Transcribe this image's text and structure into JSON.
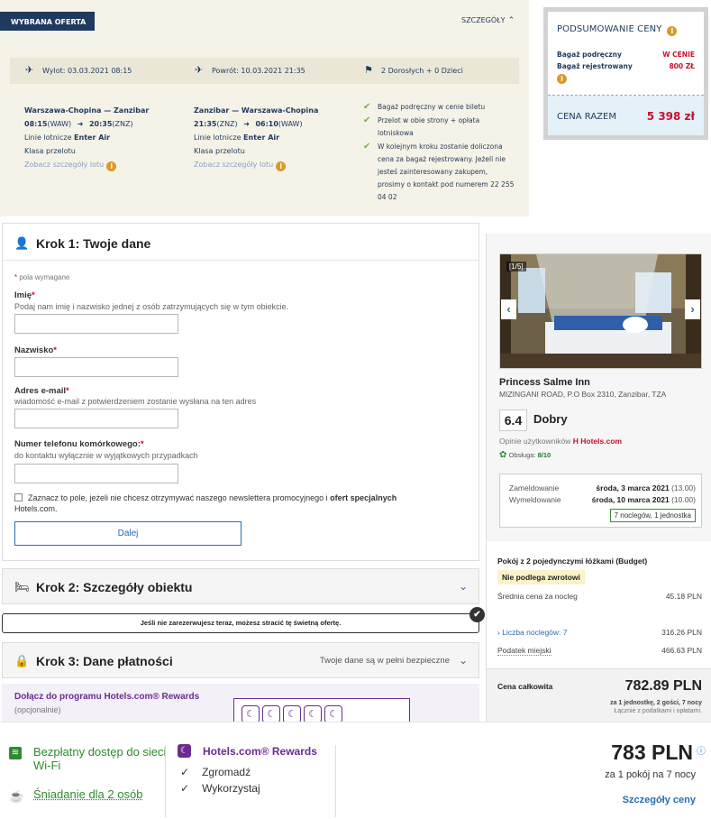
{
  "offer": {
    "tag": "WYBRANA OFERTA",
    "details_label": "SZCZEGÓŁY",
    "departure": "Wylot: 03.03.2021 08:15",
    "return": "Powrót: 10.03.2021 21:35",
    "passengers": "2 Dorosłych + 0 Dzieci",
    "outbound": {
      "route": "Warszawa-Chopina — Zanzibar",
      "dep_time": "08:15",
      "dep_code": "(WAW)",
      "arr_time": "20:35",
      "arr_code": "(ZNZ)",
      "airline_prefix": "Linie lotnicze ",
      "airline": "Enter Air",
      "class": "Klasa przelotu",
      "link": "Zobacz szczegóły lotu"
    },
    "inbound": {
      "route": "Zanzibar — Warszawa-Chopina",
      "dep_time": "21:35",
      "dep_code": "(ZNZ)",
      "arr_time": "06:10",
      "arr_code": "(WAW)",
      "airline_prefix": "Linie lotnicze ",
      "airline": "Enter Air",
      "class": "Klasa przelotu",
      "link": "Zobacz szczegóły lotu"
    },
    "checks": [
      "Bagaż podręczny w cenie biletu",
      "Przelot w obie strony + opłata lotniskowa",
      "W kolejnym kroku zostanie doliczona cena za bagaż rejestrowany. Jeżeli nie jesteś zainteresowany zakupem, prosimy o kontakt pod numerem 22 255 04 02"
    ]
  },
  "summary": {
    "title": "PODSUMOWANIE CENY",
    "row1_label": "Bagaż podręczny",
    "row1_value": "W CENIE",
    "row2_label": "Bagaż rejestrowany",
    "row2_value": "800 ZŁ",
    "total_label": "CENA RAZEM",
    "total_value": "5 398 zł"
  },
  "step1": {
    "title": "Krok 1: Twoje dane",
    "required_note": "pola wymagane",
    "first_name_label": "Imię",
    "first_name_hint": "Podaj nam imię i nazwisko jednej z osób zatrzymujących się w tym obiekcie.",
    "last_name_label": "Nazwisko",
    "email_label": "Adres e-mail",
    "email_hint": "wiadomość e-mail z potwierdzeniem zostanie wysłana na ten adres",
    "phone_label": "Numer telefonu komórkowego:",
    "phone_hint": "do kontaktu wyłącznie w wyjątkowych przypadkach",
    "newsletter_text": "Zaznacz to pole, jeżeli nie chcesz otrzymywać naszego newslettera promocyjnego i ",
    "newsletter_bold": "ofert specjalnych",
    "newsletter_tail": "Hotels.com.",
    "next_button": "Dalej"
  },
  "step2": {
    "title": "Krok 2: Szczegóły obiektu"
  },
  "alert": {
    "text": "Jeśli nie zarezerwujesz teraz, możesz stracić tę świetną ofertę."
  },
  "step3": {
    "title": "Krok 3: Dane płatności",
    "secure": "Twoje dane są w pełni bezpieczne"
  },
  "rewards": {
    "title": "Dołącz do programu Hotels.com® Rewards",
    "subtitle": "(opcjonalnie)"
  },
  "hotel": {
    "image_counter": "[1/5]",
    "name": "Princess Salme Inn",
    "address": "MIZINGANI ROAD, P.O Box 2310, Zanzibar, TZA",
    "score": "6.4",
    "score_label": "Dobry",
    "opinions": "Opinie użytkowników",
    "opinions_brand": "Hotels.com",
    "service_label": "Obsługa: ",
    "service_value": "8/10",
    "checkin_label": "Zameldowanie",
    "checkin_value": "środa, 3 marca 2021",
    "checkin_time": "(13.00)",
    "checkout_label": "Wymeldowanie",
    "checkout_value": "środa, 10 marca 2021",
    "checkout_time": "(10.00)",
    "nights_badge": "7 noclegów, 1 jednostka"
  },
  "room": {
    "title": "Pokój z 2 pojedynczymi łóżkami (Budget)",
    "non_refundable": "Nie podlega zwrotowi",
    "avg_label": "Średnia cena za nocleg",
    "avg_value": "45.18 PLN",
    "nights_label": "Liczba noclegów: 7",
    "nights_value": "316.26 PLN",
    "tax_label": "Podatek miejski",
    "tax_value": "466.63 PLN",
    "total_label": "Cena całkowita",
    "total_value": "782.89 PLN",
    "total_sub1": "za 1 jednostkę, 2 gości, 7 nocy",
    "total_sub2": "Łącznie z podatkami i opłatami."
  },
  "bottom": {
    "wifi": "Bezpłatny dostęp do sieci Wi-Fi",
    "breakfast": "Śniadanie dla 2 osób",
    "rewards_title": "Hotels.com® Rewards",
    "collect": "Zgromadź",
    "redeem": "Wykorzystaj",
    "price": "783 PLN",
    "per": "za 1 pokój na 7 nocy",
    "details": "Szczegóły ceny"
  },
  "colors": {
    "accent": "#2c6bb3",
    "brand_red": "#c8102e",
    "rewards_purple": "#6b2c91",
    "green": "#2e8b2e"
  }
}
